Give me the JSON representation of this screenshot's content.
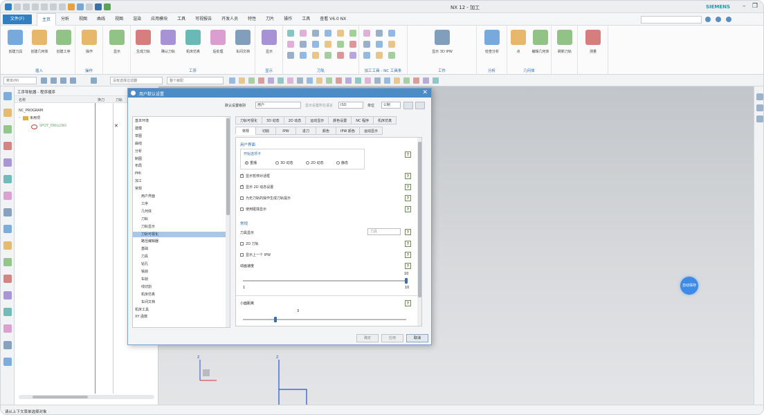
{
  "window": {
    "title": "NX 12 - 加工",
    "brand": "SIEMENS",
    "minimize": "–",
    "restore": "❐"
  },
  "menubar": {
    "file": "文件(F)",
    "tabs": [
      "主页",
      "分析",
      "视图",
      "曲线",
      "视图",
      "渲染",
      "应用模块",
      "工具",
      "可视报告",
      "开发人员",
      "特性",
      "刀片",
      "操作",
      "工具",
      "查看 V6.0 NX"
    ],
    "active_index": 0
  },
  "ribbon": {
    "groups": [
      {
        "label": "插入",
        "items": [
          "创建刀具",
          "创建几何体",
          "创建工序"
        ]
      },
      {
        "label": "操作",
        "items": [
          "操作"
        ]
      },
      {
        "label": "",
        "items": [
          "显示"
        ]
      },
      {
        "label": "工序",
        "items": [
          "生成刀轨",
          "确认刀轨",
          "机床仿真",
          "后处理",
          "车间文档"
        ]
      },
      {
        "label": "显示",
        "items": [
          "显示"
        ]
      },
      {
        "label": "刀轨",
        "items": []
      },
      {
        "label": "加工工具 - NC 工具条",
        "items": []
      },
      {
        "label": "工件",
        "items": [
          "显示 3D IPW"
        ]
      },
      {
        "label": "分析",
        "items": [
          "检查分析"
        ]
      },
      {
        "label": "几何体",
        "items": [
          "点",
          "编辑几何体"
        ]
      },
      {
        "label": "",
        "items": [
          "刷新刀轨"
        ]
      },
      {
        "label": "",
        "items": [
          "测量"
        ]
      }
    ]
  },
  "toolbar2": {
    "dropdown1": "菜单(M)",
    "dropdown2": "没有选择过滤器",
    "dropdown3": "整个装配"
  },
  "navigator": {
    "title": "工序导航器 - 程序顺序",
    "columns": [
      "名称",
      "换刀",
      "刀轨"
    ],
    "rows": [
      {
        "name": "NC_PROGRAM",
        "mark": ""
      },
      {
        "name": "未用项",
        "mark": ""
      },
      {
        "name": "SPOT_DRILLING",
        "mark": "✕"
      }
    ]
  },
  "dialog": {
    "title": "用户默认设置",
    "close": "✕",
    "top": {
      "level_label": "默认设置级别",
      "level_value": "用户",
      "lang_label": "显示设置所在语言",
      "lang_value": "ISO",
      "unit_label": "单位",
      "unit_value": "公制"
    },
    "tree": [
      "基本环境",
      "建模",
      "草图",
      "曲线",
      "分析",
      "制图",
      "布局",
      "PMI",
      "加工",
      "常规",
      "用户界面",
      "工序",
      "几何体",
      "刀轨",
      "刀轨显示",
      "刀轨可视化",
      "路径编辑器",
      "基础",
      "刀具",
      "钻孔",
      "铣削",
      "车削",
      "线切割",
      "机床仿真",
      "车间文档",
      "机床工具",
      "XY 函数"
    ],
    "tree_selected": 15,
    "tabs_row1": [
      "刀轨可视化",
      "3D 动态",
      "2D 动态",
      "运动显示",
      "颜色设置",
      "NC 程序",
      "机床仿真"
    ],
    "tabs_row2": [
      "常规",
      "切削",
      "IPW",
      "进刀",
      "颜色",
      "IPW 颜色",
      "运动显示"
    ],
    "active_tab": "常规",
    "section1": "用户界面",
    "group1_title": "开始选项卡",
    "radios": [
      "重播",
      "3D 动态",
      "2D 动态",
      "静态"
    ],
    "radio_selected": 0,
    "checks": [
      {
        "label": "显示暂停对话框",
        "checked": true
      },
      {
        "label": "显示 2D 动态设置",
        "checked": true
      },
      {
        "label": "为无刀轨的操作生成刀轨提示",
        "checked": false
      },
      {
        "label": "使用碰撞显示",
        "checked": false
      }
    ],
    "section2": "常规",
    "tool_display_label": "刀具显示",
    "tool_display_value": "刀具",
    "checks2": [
      {
        "label": "2D 刀轨",
        "checked": false
      },
      {
        "label": "显示上一个 IPW",
        "checked": false
      }
    ],
    "speed_label": "动画速度",
    "speed_value": "10",
    "speed_min": "1",
    "speed_max": "10",
    "speed_fraction": 1.0,
    "size_label": "小面距离",
    "size_value": "3",
    "size_fraction": 0.2,
    "help": "?",
    "buttons": {
      "ok": "确定",
      "apply": "应用",
      "cancel": "取消"
    }
  },
  "canvas": {
    "status_dot": "自动保存"
  },
  "status": {
    "text": "请从上下文菜单选择对象"
  },
  "colors": {
    "accent": "#2f7fc1",
    "dialog_title": "#4b8bc6",
    "selection": "#a7c8e6",
    "brand": "#1c9ba8"
  }
}
